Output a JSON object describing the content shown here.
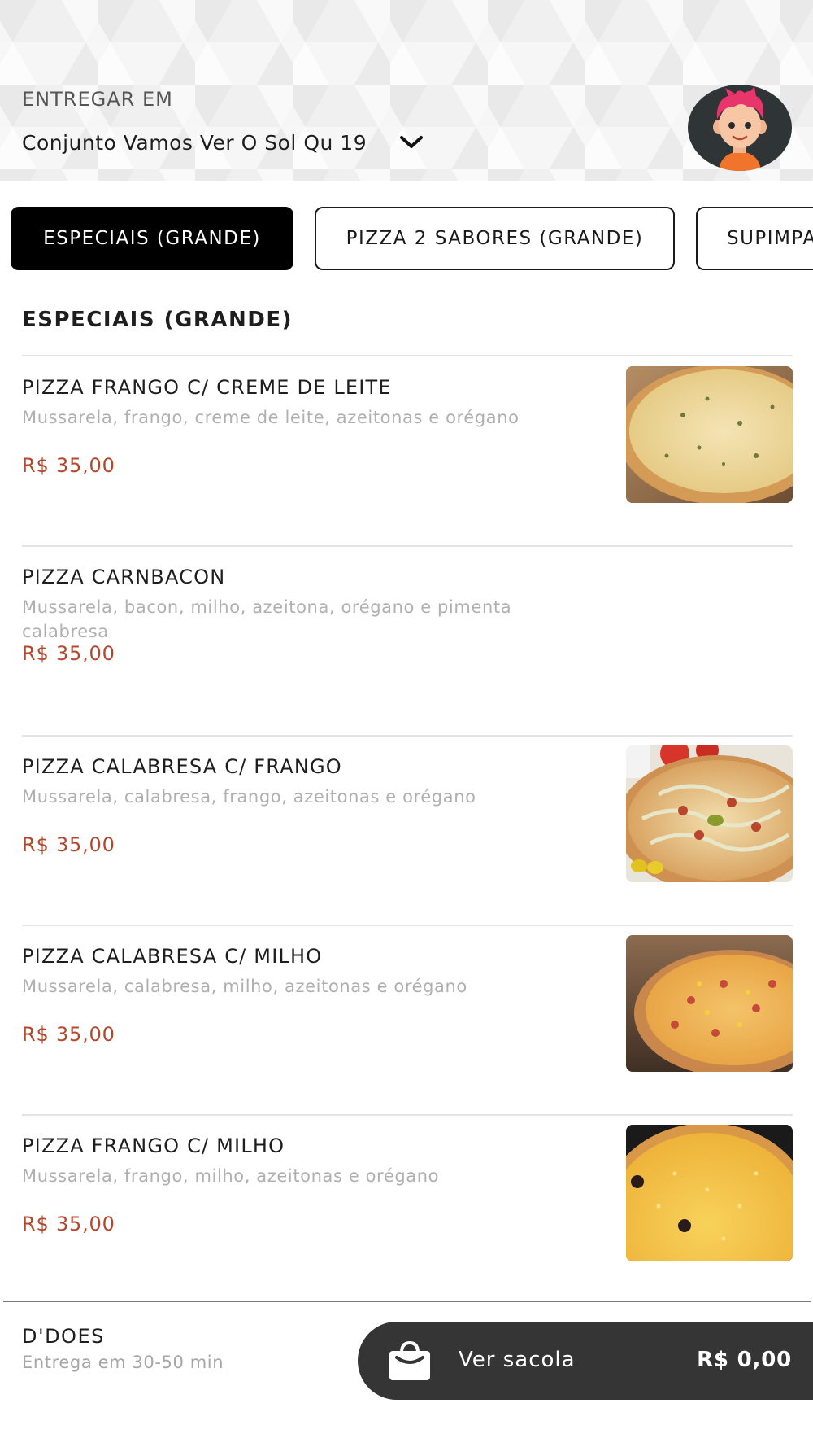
{
  "header": {
    "deliver_label": "ENTREGAR EM",
    "address": "Conjunto Vamos Ver O Sol Qu 19"
  },
  "tabs": [
    {
      "label": "ESPECIAIS (GRANDE)",
      "active": true
    },
    {
      "label": "PIZZA 2 SABORES (GRANDE)",
      "active": false
    },
    {
      "label": "SUPIMPA",
      "active": false
    }
  ],
  "section": {
    "title": "ESPECIAIS (GRANDE)"
  },
  "products": [
    {
      "name": "PIZZA FRANGO C/ CREME DE LEITE",
      "description": "Mussarela, frango, creme de leite, azeitonas e orégano",
      "price": "R$ 35,00",
      "has_image": true
    },
    {
      "name": "PIZZA CARNBACON",
      "description": "Mussarela, bacon, milho, azeitona, orégano e pimenta calabresa",
      "price": "R$ 35,00",
      "has_image": false
    },
    {
      "name": "PIZZA CALABRESA C/ FRANGO",
      "description": "Mussarela, calabresa, frango, azeitonas e orégano",
      "price": "R$ 35,00",
      "has_image": true
    },
    {
      "name": "PIZZA CALABRESA C/ MILHO",
      "description": "Mussarela, calabresa, milho, azeitonas e orégano",
      "price": "R$ 35,00",
      "has_image": true
    },
    {
      "name": "PIZZA FRANGO C/ MILHO",
      "description": "Mussarela, frango, milho, azeitonas e orégano",
      "price": "R$ 35,00",
      "has_image": true
    }
  ],
  "footer": {
    "store_name": "D'DOES",
    "delivery_time": "Entrega em 30-50 min",
    "bag_label": "Ver sacola",
    "bag_total": "R$ 0,00"
  },
  "colors": {
    "price": "#b4482c",
    "active_tab_bg": "#000000",
    "bag_button_bg": "#353535",
    "description": "#b0b0b0"
  },
  "icons": [
    "chevron-down-icon",
    "user-avatar",
    "shopping-bag-icon"
  ]
}
